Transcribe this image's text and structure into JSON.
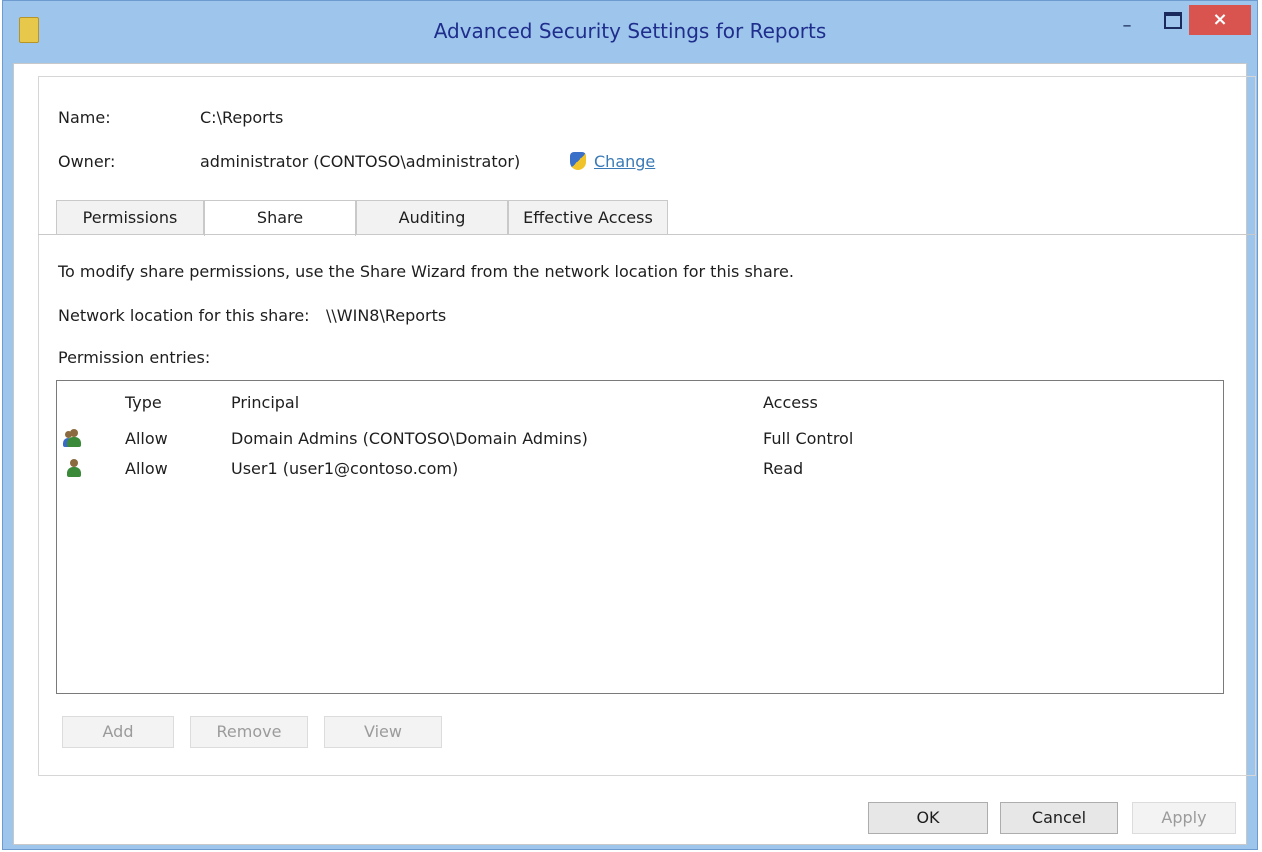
{
  "window": {
    "title": "Advanced Security Settings for Reports",
    "minimize": "–",
    "close": "×"
  },
  "header": {
    "name_label": "Name:",
    "name_value": "C:\\Reports",
    "owner_label": "Owner:",
    "owner_value": "administrator (CONTOSO\\administrator)",
    "change_link": "Change"
  },
  "tabs": [
    {
      "label": "Permissions",
      "active": false
    },
    {
      "label": "Share",
      "active": true
    },
    {
      "label": "Auditing",
      "active": false
    },
    {
      "label": "Effective Access",
      "active": false
    }
  ],
  "share_tab": {
    "info_text": "To modify share permissions, use the Share Wizard from the network location for this share.",
    "network_location_label": "Network location for this share:",
    "network_location_value": "\\\\WIN8\\Reports",
    "entries_label": "Permission entries:"
  },
  "table": {
    "columns": [
      "Type",
      "Principal",
      "Access"
    ],
    "rows": [
      {
        "icon": "group-users-icon",
        "type": "Allow",
        "principal": "Domain Admins (CONTOSO\\Domain Admins)",
        "access": "Full Control"
      },
      {
        "icon": "user-icon",
        "type": "Allow",
        "principal": "User1 (user1@contoso.com)",
        "access": "Read"
      }
    ]
  },
  "entry_buttons": {
    "add": "Add",
    "remove": "Remove",
    "view": "View"
  },
  "dialog_buttons": {
    "ok": "OK",
    "cancel": "Cancel",
    "apply": "Apply"
  },
  "colors": {
    "title_text": "#1f2e8c",
    "window_frame": "#9ec6ec",
    "link": "#3a7ab5",
    "close_button": "#d9534f"
  }
}
